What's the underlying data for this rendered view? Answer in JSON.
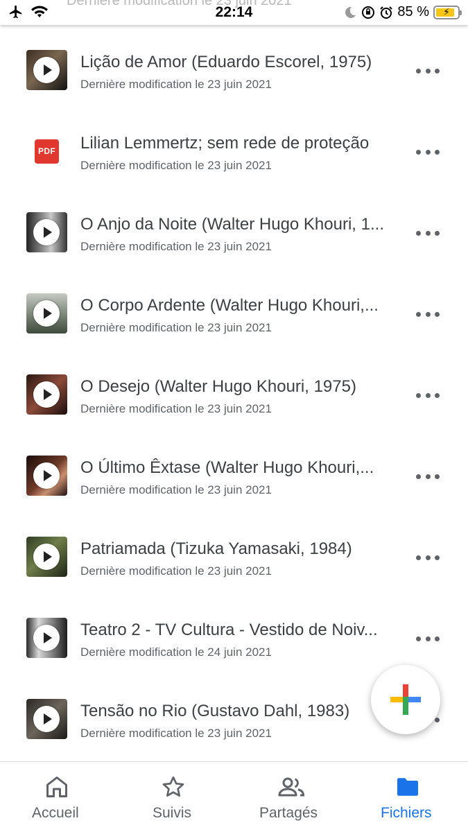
{
  "status_bar": {
    "time": "22:14",
    "battery_percent": "85 %",
    "ghost_text": "Dernière modification le 23 juin 2021",
    "battery_level": 0.85,
    "icons": [
      "airplane-icon",
      "wifi-icon",
      "moon-icon",
      "rotation-lock-icon",
      "alarm-icon",
      "battery-charging-icon"
    ]
  },
  "files": [
    {
      "title": "Lição de Amor (Eduardo Escorel, 1975)",
      "meta": "Dernière modification le 23 juin 2021",
      "kind": "video"
    },
    {
      "title": "Lilian Lemmertz; sem rede de proteção",
      "meta": "Dernière modification le 23 juin 2021",
      "kind": "pdf",
      "badge": "PDF"
    },
    {
      "title": "O Anjo da Noite (Walter Hugo Khouri, 1...",
      "meta": "Dernière modification le 23 juin 2021",
      "kind": "video"
    },
    {
      "title": "O Corpo Ardente (Walter Hugo Khouri,...",
      "meta": "Dernière modification le 23 juin 2021",
      "kind": "video"
    },
    {
      "title": "O Desejo (Walter Hugo Khouri, 1975)",
      "meta": "Dernière modification le 23 juin 2021",
      "kind": "video"
    },
    {
      "title": "O Último Êxtase (Walter Hugo Khouri,...",
      "meta": "Dernière modification le 23 juin 2021",
      "kind": "video"
    },
    {
      "title": "Patriamada (Tizuka Yamasaki, 1984)",
      "meta": "Dernière modification le 23 juin 2021",
      "kind": "video"
    },
    {
      "title": "Teatro 2 - TV Cultura - Vestido de Noiv...",
      "meta": "Dernière modification le 24 juin 2021",
      "kind": "video"
    },
    {
      "title": "Tensão no Rio (Gustavo Dahl, 1983)",
      "meta": "Dernière modification le 23 juin 2021",
      "kind": "video"
    }
  ],
  "fab": {
    "icon": "add-icon",
    "colors": [
      "#ea4335",
      "#fbbc04",
      "#34a853",
      "#4285f4"
    ]
  },
  "bottom_nav": {
    "items": [
      {
        "label": "Accueil",
        "icon": "home-icon"
      },
      {
        "label": "Suivis",
        "icon": "star-icon"
      },
      {
        "label": "Partagés",
        "icon": "people-icon"
      },
      {
        "label": "Fichiers",
        "icon": "folder-icon",
        "active": true
      }
    ],
    "active_color": "#1a73e8",
    "inactive_color": "#5f6368"
  }
}
